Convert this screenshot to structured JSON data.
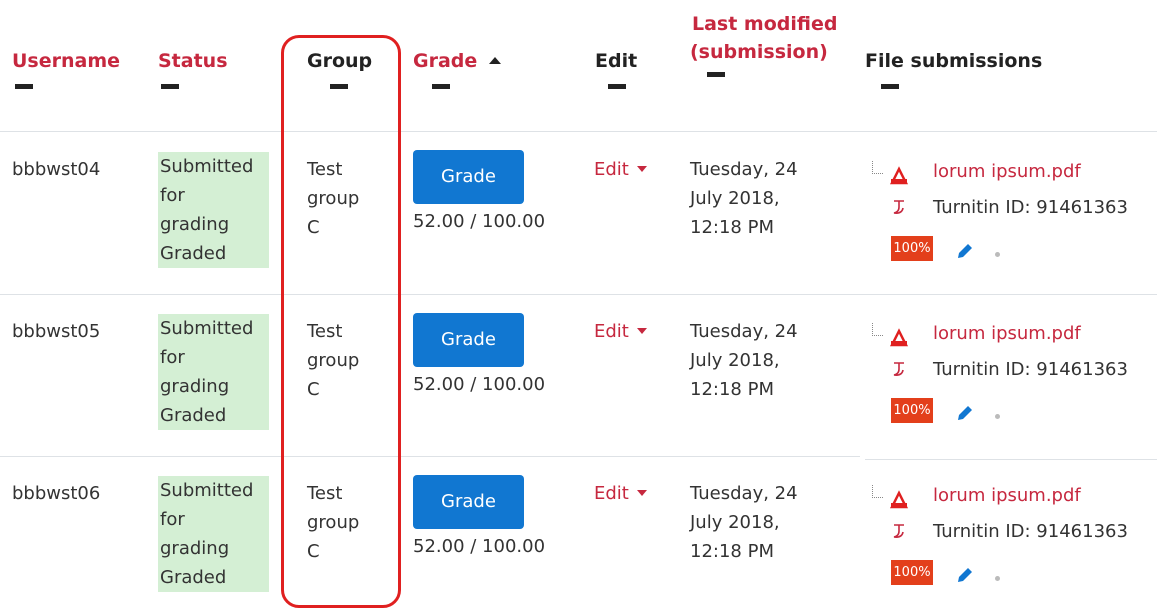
{
  "headers": {
    "username": "Username",
    "status": "Status",
    "group": "Group",
    "grade": "Grade",
    "edit": "Edit",
    "last_modified_1": "Last modified",
    "last_modified_2": "(submission)",
    "file_submissions": "File submissions"
  },
  "rows": [
    {
      "username": "bbbwst04",
      "status_lines": [
        "Submitted",
        "for",
        "grading",
        "Graded"
      ],
      "group_lines": [
        "Test",
        "group",
        "C"
      ],
      "grade_button": "Grade",
      "grade_value": "52.00 / 100.00",
      "edit": "Edit",
      "date_lines": [
        "Tuesday, 24",
        "July 2018,",
        "12:18 PM"
      ],
      "file_name": "lorum ipsum.pdf",
      "turnitin": "Turnitin ID: 91461363",
      "score": "100%"
    },
    {
      "username": "bbbwst05",
      "status_lines": [
        "Submitted",
        "for",
        "grading",
        "Graded"
      ],
      "group_lines": [
        "Test",
        "group",
        "C"
      ],
      "grade_button": "Grade",
      "grade_value": "52.00 / 100.00",
      "edit": "Edit",
      "date_lines": [
        "Tuesday, 24",
        "July 2018,",
        "12:18 PM"
      ],
      "file_name": "lorum ipsum.pdf",
      "turnitin": "Turnitin ID: 91461363",
      "score": "100%"
    },
    {
      "username": "bbbwst06",
      "status_lines": [
        "Submitted",
        "for",
        "grading",
        "Graded"
      ],
      "group_lines": [
        "Test",
        "group",
        "C"
      ],
      "grade_button": "Grade",
      "grade_value": "52.00 / 100.00",
      "edit": "Edit",
      "date_lines": [
        "Tuesday, 24",
        "July 2018,",
        "12:18 PM"
      ],
      "file_name": "lorum ipsum.pdf",
      "turnitin": "Turnitin ID: 91461363",
      "score": "100%"
    }
  ],
  "icons": {
    "pdf": "pdf-file-icon",
    "turnitin": "turnitin-icon",
    "pencil": "pencil-icon",
    "sort": "sort-ascending-icon",
    "caret": "caret-down-icon"
  },
  "colors": {
    "link": "#c6283f",
    "grade_button": "#1177d1",
    "status_bg": "#d4efd4",
    "score_bg": "#e33f1b",
    "highlight": "#e02020"
  }
}
